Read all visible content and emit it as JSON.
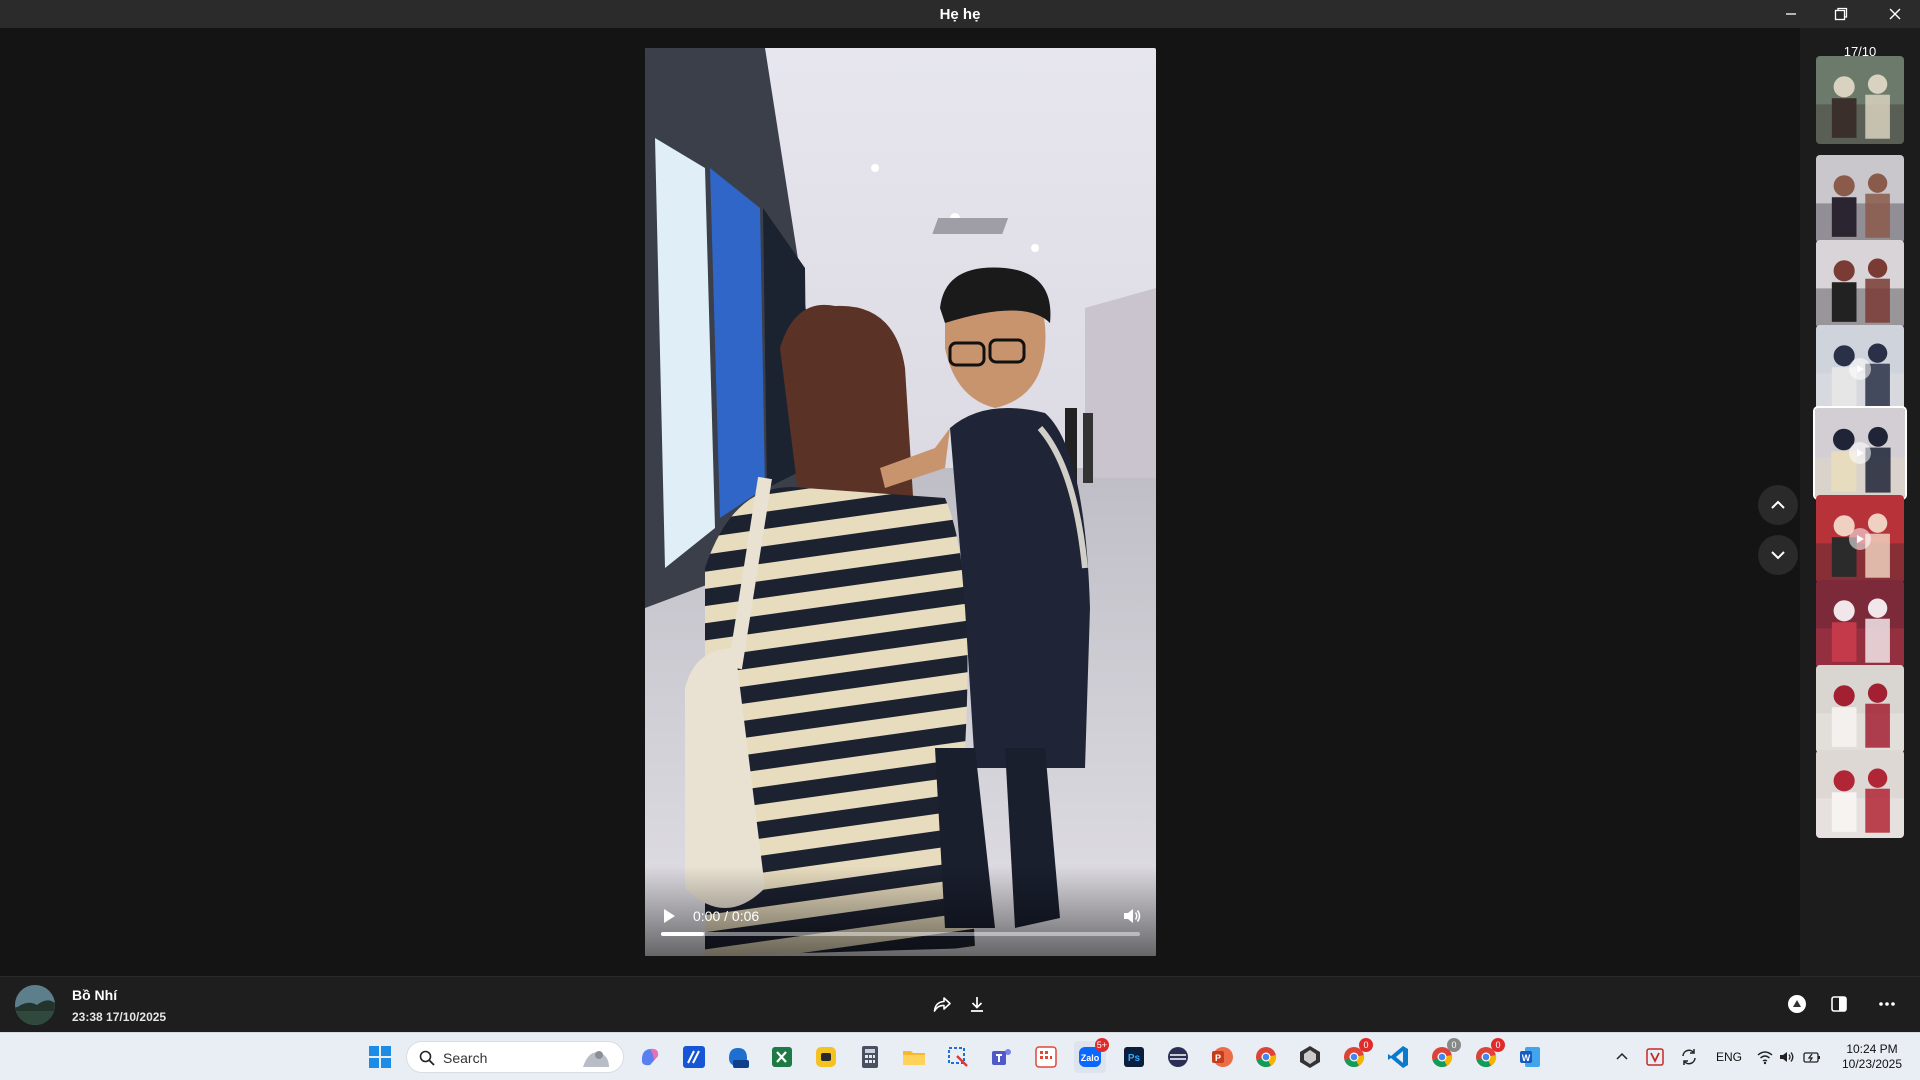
{
  "window": {
    "title": "Hẹ hẹ"
  },
  "video": {
    "time_display": "0:00 / 0:06",
    "progress_fraction": 0.09
  },
  "rail": {
    "counter": "17/10",
    "thumbnails": [
      {
        "kind": "photo",
        "active": false
      },
      {
        "kind": "photo",
        "active": false
      },
      {
        "kind": "photo",
        "active": false
      },
      {
        "kind": "video",
        "active": false
      },
      {
        "kind": "video",
        "active": true
      },
      {
        "kind": "video",
        "active": false
      },
      {
        "kind": "photo",
        "active": false
      },
      {
        "kind": "photo",
        "active": false
      },
      {
        "kind": "photo",
        "active": false
      }
    ]
  },
  "message": {
    "sender": "Bồ Nhí",
    "timestamp": "23:38 17/10/2025"
  },
  "taskbar": {
    "search_placeholder": "Search",
    "zalo_badge": "5+",
    "chrome_badges": [
      "0",
      "0",
      "0"
    ],
    "language": "ENG",
    "time": "10:24 PM",
    "date": "10/23/2025"
  },
  "colors": {
    "titlebar": "#2b2b2b",
    "viewer_bg": "#141414",
    "rail_bg": "#1c1c1c",
    "taskbar_bg": "#e9eef5",
    "badge": "#e02b2b"
  }
}
